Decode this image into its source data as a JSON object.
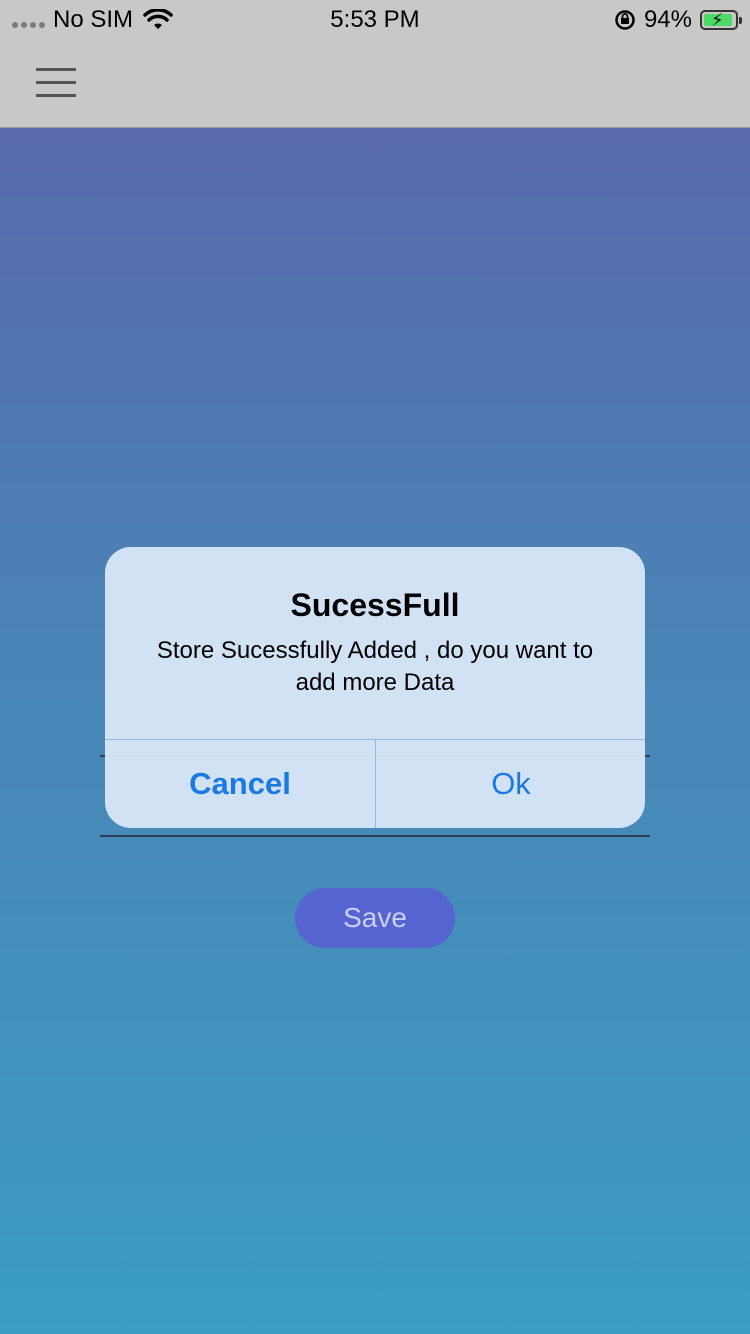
{
  "status_bar": {
    "carrier": "No SIM",
    "time": "5:53 PM",
    "battery_percent": "94%",
    "battery_level": 0.94,
    "icons": [
      "signal-dots-icon",
      "wifi-icon",
      "rotation-lock-icon",
      "battery-icon"
    ]
  },
  "nav": {
    "menu_icon": "hamburger-icon"
  },
  "form": {
    "save_label": "Save"
  },
  "alert": {
    "title": "SucessFull",
    "message": "Store Sucessfully Added , do you want to add more Data",
    "cancel_label": "Cancel",
    "ok_label": "Ok",
    "button_color": "#1a7ae2"
  },
  "colors": {
    "bar_background": "#c8c8c8",
    "gradient_top": "#5869ad",
    "gradient_bottom": "#3b9dc2",
    "save_button": "#5564d0",
    "battery_green": "#4cd964"
  }
}
